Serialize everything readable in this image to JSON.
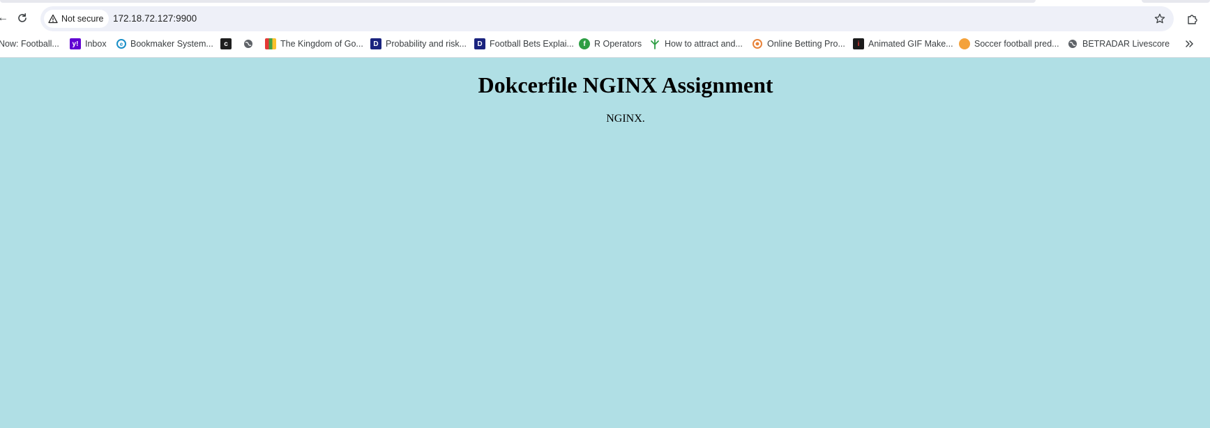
{
  "browser": {
    "security_label": "Not secure",
    "url": "172.18.72.127:9900",
    "icons": {
      "reload": "reload-icon",
      "warning": "warning-triangle-icon",
      "star": "star-icon",
      "extensions": "extensions-icon",
      "more_bookmarks": "chevron-double-right-icon"
    }
  },
  "bookmarks": [
    {
      "label": "Now: Football...",
      "icon": "site-icon"
    },
    {
      "label": "Inbox",
      "icon": "yahoo-mail-icon"
    },
    {
      "label": "Bookmaker System...",
      "icon": "bookmaker-icon"
    },
    {
      "label": "",
      "icon": "dark-app-icon"
    },
    {
      "label": "",
      "icon": "globe-icon"
    },
    {
      "label": "The Kingdom of Go...",
      "icon": "colorful-grid-icon"
    },
    {
      "label": "Probability and risk...",
      "icon": "d-blue-icon"
    },
    {
      "label": "Football Bets Explai...",
      "icon": "d-blue-icon"
    },
    {
      "label": "R Operators",
      "icon": "green-f-icon"
    },
    {
      "label": "How to attract and...",
      "icon": "tree-icon"
    },
    {
      "label": "Online Betting Pro...",
      "icon": "orange-ring-icon"
    },
    {
      "label": "Animated GIF Make...",
      "icon": "gif-maker-icon"
    },
    {
      "label": "Soccer football pred...",
      "icon": "orange-ball-icon"
    },
    {
      "label": "BETRADAR Livescore",
      "icon": "globe-icon"
    }
  ],
  "page": {
    "heading": "Dokcerfile NGINX Assignment",
    "text": "NGINX.",
    "background_color": "#b0dfe5"
  }
}
